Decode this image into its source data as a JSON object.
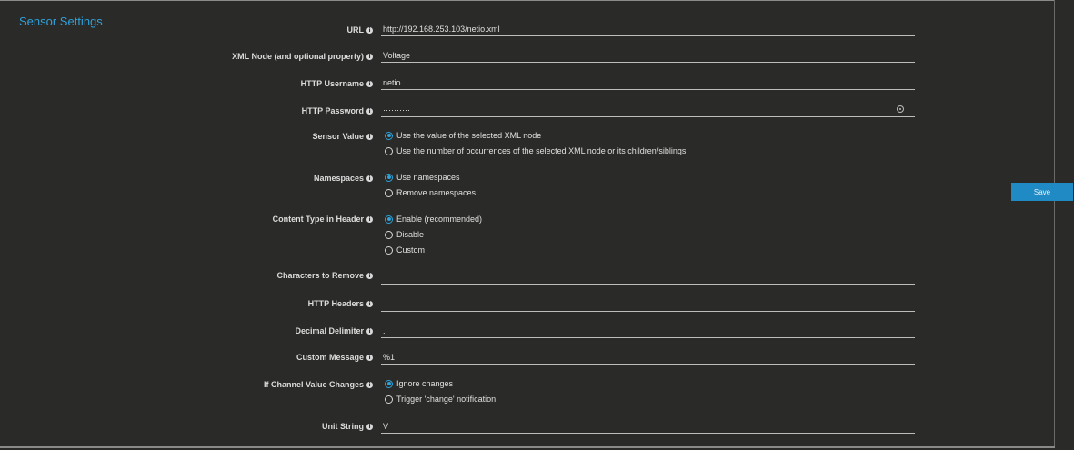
{
  "section": {
    "title": "Sensor Settings"
  },
  "fields": {
    "url": {
      "label": "URL",
      "value": "http://192.168.253.103/netio.xml"
    },
    "xml_node": {
      "label": "XML Node (and optional property)",
      "value": "Voltage"
    },
    "http_username": {
      "label": "HTTP Username",
      "value": "netio"
    },
    "http_password": {
      "label": "HTTP Password",
      "value": "··········"
    },
    "sensor_value": {
      "label": "Sensor Value",
      "options": [
        "Use the value of the selected XML node",
        "Use the number of occurrences of the selected XML node or its children/siblings"
      ],
      "selected": 0
    },
    "namespaces": {
      "label": "Namespaces",
      "options": [
        "Use namespaces",
        "Remove namespaces"
      ],
      "selected": 0
    },
    "content_type": {
      "label": "Content Type in Header",
      "options": [
        "Enable (recommended)",
        "Disable",
        "Custom"
      ],
      "selected": 0
    },
    "chars_to_remove": {
      "label": "Characters to Remove",
      "value": ""
    },
    "http_headers": {
      "label": "HTTP Headers",
      "value": ""
    },
    "decimal_delimiter": {
      "label": "Decimal Delimiter",
      "value": "."
    },
    "custom_message": {
      "label": "Custom Message",
      "value": "%1"
    },
    "channel_value_changes": {
      "label": "If Channel Value Changes",
      "options": [
        "Ignore changes",
        "Trigger 'change' notification"
      ],
      "selected": 0
    },
    "unit_string": {
      "label": "Unit String",
      "value": "V"
    }
  },
  "actions": {
    "save_label": "Save"
  },
  "icons": {
    "info": "info-icon",
    "password_reveal": "eye-icon"
  },
  "colors": {
    "accent": "#2ea3dc",
    "background": "#2a2a28"
  }
}
